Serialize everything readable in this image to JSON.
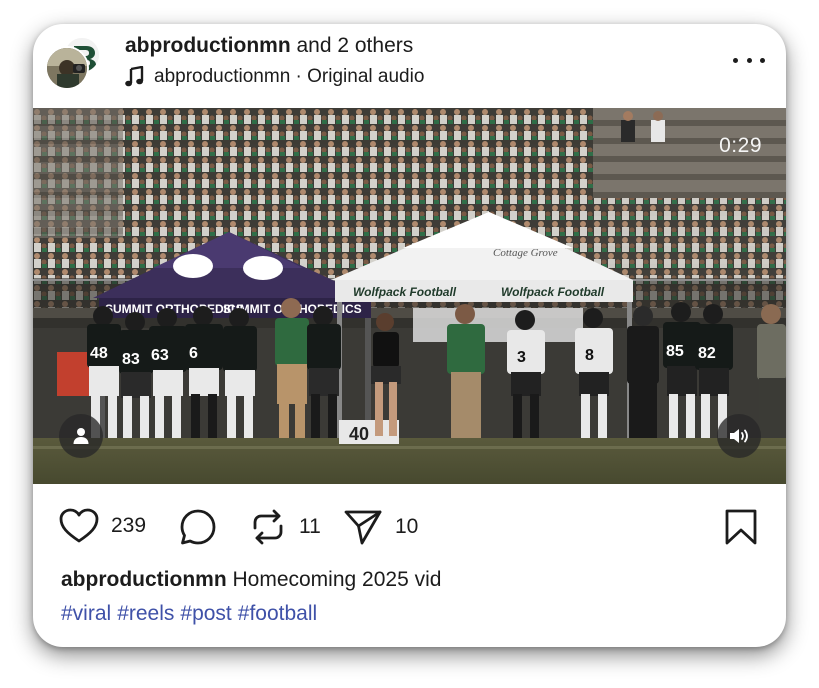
{
  "post": {
    "author": "abproductionmn",
    "coauthors_text": " and 2 others",
    "audio_owner": "abproductionmn",
    "audio_separator": " · ",
    "audio_label": "Original audio",
    "video_time": "0:29",
    "likes": "239",
    "reposts": "11",
    "shares": "10",
    "caption_user": "abproductionmn",
    "caption_text": " Homecoming 2025 vid",
    "hashtags": [
      "#viral",
      "#reels",
      "#post",
      "#football"
    ]
  },
  "scene": {
    "tent_left_banner": "SUMMIT ORTHOPEDICS",
    "tent_left_banner_2": "SUMMIT ORTHOPEDICS",
    "tent_right_label_1": "Wolfpack Football",
    "tent_right_label_2": "Wolfpack Football",
    "tent_right_roof": "Cottage Grove",
    "jersey_numbers": [
      "48",
      "83",
      "63",
      "6",
      "3",
      "8",
      "85",
      "82",
      "40"
    ]
  },
  "icons": {
    "music": "music-note-icon",
    "more": "more-options-icon",
    "tag": "person-tag-icon",
    "sound": "speaker-icon",
    "like": "heart-icon",
    "comment": "comment-bubble-icon",
    "repost": "repost-arrows-icon",
    "share": "paper-plane-icon",
    "save": "bookmark-icon"
  },
  "colors": {
    "hashtag": "#3f51a8",
    "text": "#1c1c1c"
  }
}
